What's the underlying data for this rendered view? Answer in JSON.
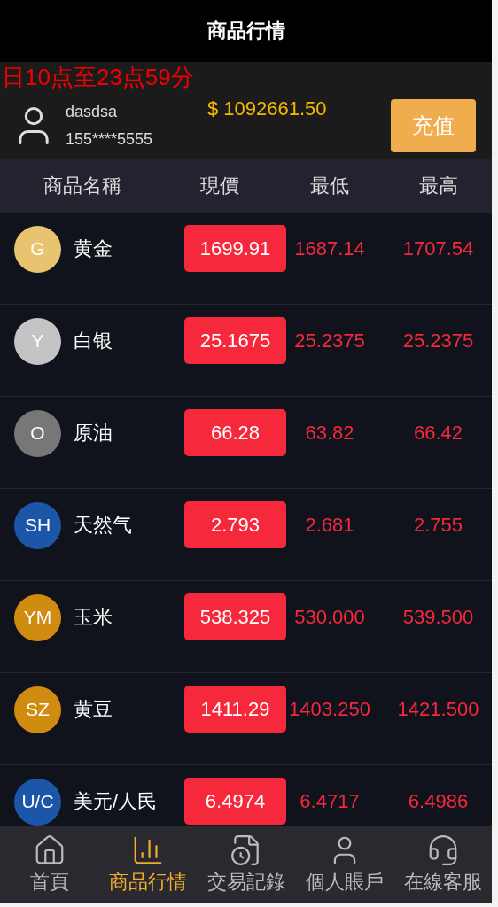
{
  "header": {
    "title": "商品行情"
  },
  "notice": "日10点至23点59分",
  "user": {
    "name": "dasdsa",
    "phone": "155****5555",
    "balance": "$ 1092661.50",
    "recharge_button": "充值"
  },
  "table": {
    "columns": [
      "商品名稱",
      "現價",
      "最低",
      "最高"
    ],
    "rows": [
      {
        "symbol": "G",
        "color": "#e8c470",
        "name": "黄金",
        "price": "1699.91",
        "low": "1687.14",
        "high": "1707.54"
      },
      {
        "symbol": "Y",
        "color": "#c4c4c4",
        "name": "白银",
        "price": "25.1675",
        "low": "25.2375",
        "high": "25.2375"
      },
      {
        "symbol": "O",
        "color": "#777777",
        "name": "原油",
        "price": "66.28",
        "low": "63.82",
        "high": "66.42"
      },
      {
        "symbol": "SH",
        "color": "#1b56a8",
        "name": "天然气",
        "price": "2.793",
        "low": "2.681",
        "high": "2.755"
      },
      {
        "symbol": "YM",
        "color": "#d08c10",
        "name": "玉米",
        "price": "538.325",
        "low": "530.000",
        "high": "539.500"
      },
      {
        "symbol": "SZ",
        "color": "#d08c10",
        "name": "黄豆",
        "price": "1411.29",
        "low": "1403.250",
        "high": "1421.500"
      },
      {
        "symbol": "U/C",
        "color": "#1b56a8",
        "name": "美元/人民",
        "price": "6.4974",
        "low": "6.4717",
        "high": "6.4986"
      }
    ]
  },
  "tabbar": [
    {
      "kind": "home",
      "label": "首頁",
      "selected": false
    },
    {
      "kind": "chart",
      "label": "商品行情",
      "selected": true
    },
    {
      "kind": "records",
      "label": "交易記錄",
      "selected": false
    },
    {
      "kind": "account",
      "label": "個人賬戶",
      "selected": false
    },
    {
      "kind": "service",
      "label": "在線客服",
      "selected": false
    }
  ]
}
